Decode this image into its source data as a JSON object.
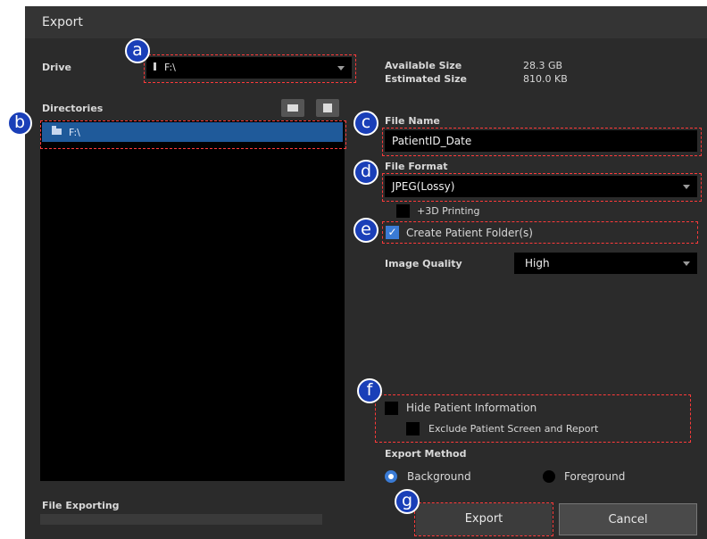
{
  "window": {
    "title": "Export"
  },
  "drive": {
    "label": "Drive",
    "value": "F:\\"
  },
  "sizes": {
    "available_label": "Available Size",
    "available_value": "28.3 GB",
    "estimated_label": "Estimated Size",
    "estimated_value": "810.0 KB"
  },
  "directories": {
    "label": "Directories",
    "items": [
      {
        "label": "F:\\"
      }
    ]
  },
  "file_name": {
    "label": "File Name",
    "value": "PatientID_Date"
  },
  "file_format": {
    "label": "File Format",
    "value": "JPEG(Lossy)"
  },
  "printing_3d": {
    "label": "+3D Printing",
    "checked": false
  },
  "create_folder": {
    "label": "Create Patient Folder(s)",
    "checked": true
  },
  "image_quality": {
    "label": "Image Quality",
    "value": "High"
  },
  "hide_patient": {
    "label": "Hide Patient Information",
    "checked": false
  },
  "exclude_screen": {
    "label": "Exclude Patient Screen and Report",
    "checked": false
  },
  "export_method": {
    "label": "Export Method",
    "background": "Background",
    "foreground": "Foreground",
    "selected": "Background"
  },
  "file_exporting": {
    "label": "File Exporting",
    "progress": 0.0
  },
  "buttons": {
    "export": "Export",
    "cancel": "Cancel"
  },
  "annotations": {
    "a": "a",
    "b": "b",
    "c": "c",
    "d": "d",
    "e": "e",
    "f": "f",
    "g": "g"
  },
  "colors": {
    "accent": "#3a7bd5",
    "highlight": "#ff3a3a",
    "badge": "#1a3fb8",
    "background": "#2b2b2b"
  }
}
